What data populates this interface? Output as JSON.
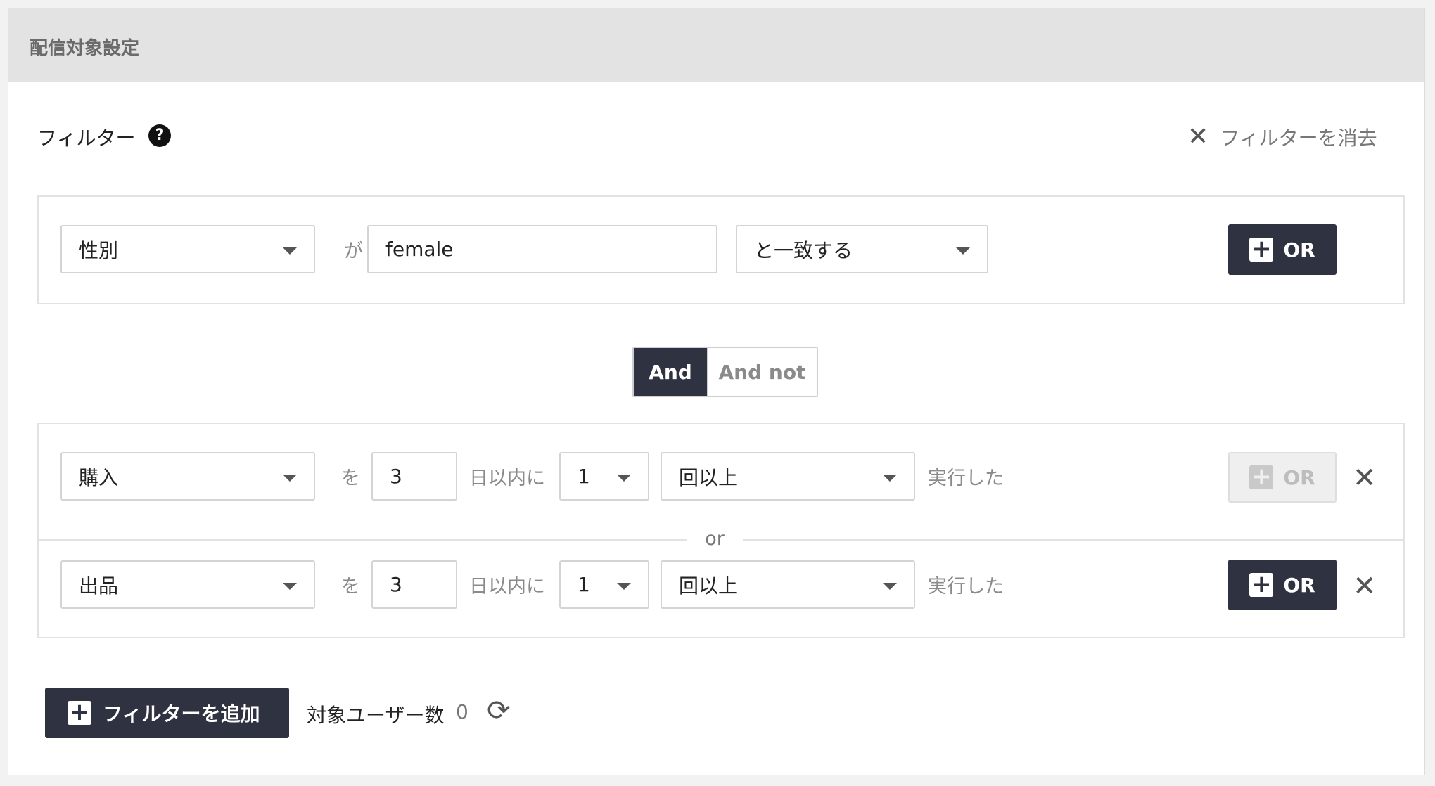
{
  "panel": {
    "title": "配信対象設定"
  },
  "filter": {
    "label": "フィルター",
    "help_icon": "question-circle-icon",
    "clear_label": "フィルターを消去"
  },
  "group1": {
    "attribute": "性別",
    "connector": "が",
    "value": "female",
    "operator": "と一致する",
    "or_label": "OR"
  },
  "toggle": {
    "on": "And",
    "off": "And not"
  },
  "group2": {
    "rows": [
      {
        "event": "購入",
        "connector_wo": "を",
        "days": "3",
        "days_suffix": "日以内に",
        "count": "1",
        "count_condition": "回以上",
        "executed": "実行した",
        "or_label": "OR",
        "or_disabled": true
      },
      {
        "event": "出品",
        "connector_wo": "を",
        "days": "3",
        "days_suffix": "日以内に",
        "count": "1",
        "count_condition": "回以上",
        "executed": "実行した",
        "or_label": "OR",
        "or_disabled": false
      }
    ],
    "or_divider": "or"
  },
  "footer": {
    "add_filter_label": "フィルターを追加",
    "target_users_label": "対象ユーザー数",
    "target_users_count": "0",
    "refresh_icon": "refresh-icon"
  }
}
